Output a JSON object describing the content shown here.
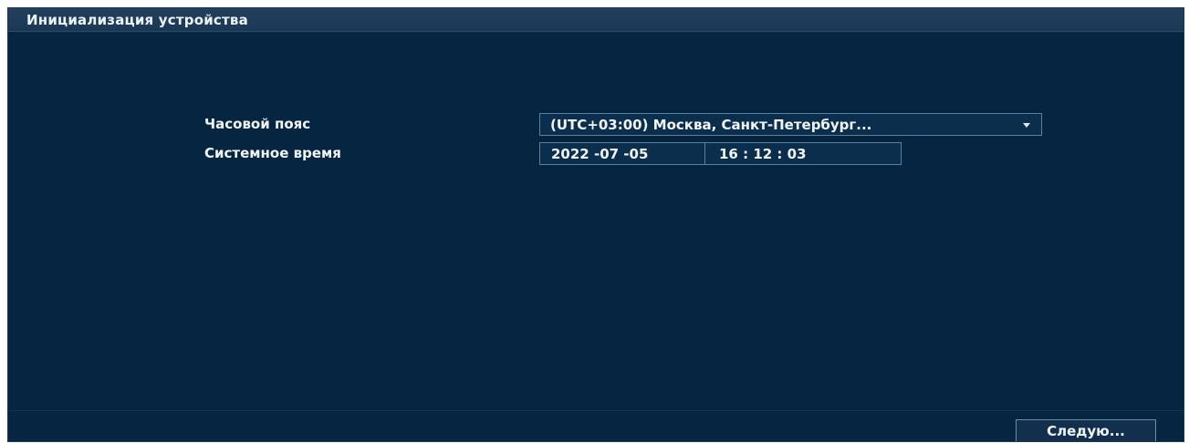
{
  "window": {
    "title": "Инициализация устройства"
  },
  "form": {
    "timezone": {
      "label": "Часовой пояс",
      "value": "(UTC+03:00) Москва, Санкт-Петербург..."
    },
    "system_time": {
      "label": "Системное время",
      "date": "2022 -07 -05",
      "time": "16 : 12 : 03"
    }
  },
  "footer": {
    "next_label": "Следую..."
  },
  "colors": {
    "background": "#062540",
    "title_bar": "#1f3c5a",
    "field_border": "#5a7f9f",
    "text": "#f2f5f8"
  },
  "icons": {
    "dropdown": "chevron-down-icon"
  }
}
